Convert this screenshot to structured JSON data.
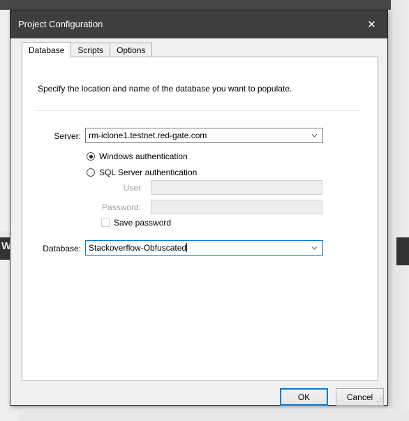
{
  "window": {
    "title": "Project Configuration",
    "close_icon": "close-icon"
  },
  "tabs": [
    {
      "label": "Database",
      "active": true
    },
    {
      "label": "Scripts",
      "active": false
    },
    {
      "label": "Options",
      "active": false
    }
  ],
  "database_tab": {
    "description": "Specify the location and name of the database you want to populate.",
    "server": {
      "label": "Server:",
      "value": "rm-iclone1.testnet.red-gate.com",
      "dropdown_icon": "chevron-down-icon"
    },
    "auth": {
      "windows_option": "Windows authentication",
      "sql_option": "SQL Server authentication",
      "selected": "windows"
    },
    "user": {
      "label": "User",
      "value": "",
      "enabled": false
    },
    "password": {
      "label": "Password:",
      "value": "",
      "enabled": false
    },
    "save_password": {
      "label": "Save password",
      "checked": false
    },
    "database": {
      "label": "Database:",
      "value": "Stackoverflow-Obfuscated",
      "focused": true,
      "dropdown_icon": "chevron-down-icon"
    }
  },
  "footer": {
    "ok_label": "OK",
    "cancel_label": "Cancel"
  },
  "background": {
    "left_window_glyph": "W"
  },
  "colors": {
    "titlebar": "#3e3e3e",
    "dialog_face": "#f0f0f0",
    "panel": "#ffffff",
    "accent_focus": "#0078d7",
    "disabled_text": "#a0a0a0",
    "disabled_field": "#efefef"
  }
}
